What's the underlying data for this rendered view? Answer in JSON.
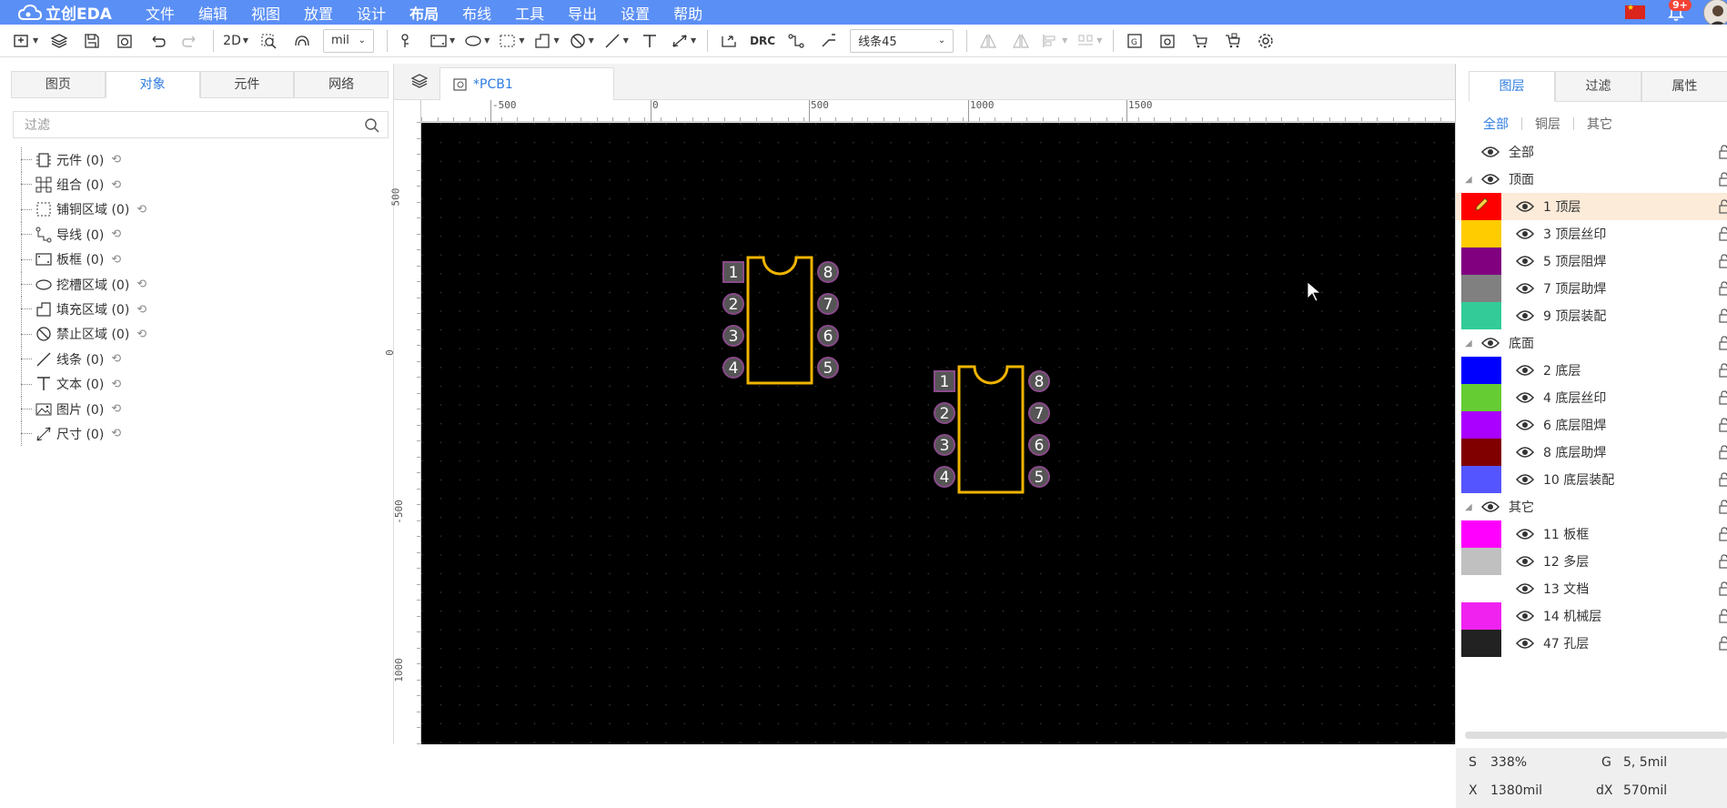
{
  "app": {
    "logo_text": "立创EDA"
  },
  "menu": [
    {
      "label": "文件"
    },
    {
      "label": "编辑"
    },
    {
      "label": "视图"
    },
    {
      "label": "放置"
    },
    {
      "label": "设计"
    },
    {
      "label": "布局",
      "active": true
    },
    {
      "label": "布线"
    },
    {
      "label": "工具"
    },
    {
      "label": "导出"
    },
    {
      "label": "设置"
    },
    {
      "label": "帮助"
    }
  ],
  "notifications": {
    "badge": "9+"
  },
  "toolbar": {
    "view_mode": "2D",
    "unit": "mil",
    "route_mode": "线条45",
    "drc_label": "DRC"
  },
  "left_panel": {
    "tabs": [
      {
        "label": "图页"
      },
      {
        "label": "对象",
        "active": true
      },
      {
        "label": "元件"
      },
      {
        "label": "网络"
      }
    ],
    "filter_placeholder": "过滤",
    "tree": [
      {
        "label": "元件 (0)",
        "icon": "component-icon"
      },
      {
        "label": "组合 (0)",
        "icon": "group-icon"
      },
      {
        "label": "铺铜区域 (0)",
        "icon": "copper-area-icon"
      },
      {
        "label": "导线 (0)",
        "icon": "track-icon"
      },
      {
        "label": "板框 (0)",
        "icon": "board-outline-icon"
      },
      {
        "label": "挖槽区域 (0)",
        "icon": "slot-area-icon"
      },
      {
        "label": "填充区域 (0)",
        "icon": "fill-area-icon"
      },
      {
        "label": "禁止区域 (0)",
        "icon": "keepout-area-icon"
      },
      {
        "label": "线条 (0)",
        "icon": "line-icon"
      },
      {
        "label": "文本 (0)",
        "icon": "text-icon"
      },
      {
        "label": "图片 (0)",
        "icon": "image-icon"
      },
      {
        "label": "尺寸 (0)",
        "icon": "dimension-icon"
      }
    ]
  },
  "canvas": {
    "doc_tab": "*PCB1",
    "top_ruler": [
      "-500",
      "0",
      "500",
      "1000",
      "1500"
    ],
    "left_ruler": [
      "500",
      "0",
      "-500",
      "1000"
    ],
    "components": [
      {
        "pins_left": [
          "1",
          "2",
          "3",
          "4"
        ],
        "pins_right": [
          "8",
          "7",
          "6",
          "5"
        ]
      },
      {
        "pins_left": [
          "1",
          "2",
          "3",
          "4"
        ],
        "pins_right": [
          "8",
          "7",
          "6",
          "5"
        ]
      }
    ]
  },
  "right_panel": {
    "tabs": [
      {
        "label": "图层",
        "active": true
      },
      {
        "label": "过滤"
      },
      {
        "label": "属性"
      }
    ],
    "filters": [
      {
        "label": "全部",
        "active": true
      },
      {
        "label": "铜层"
      },
      {
        "label": "其它"
      }
    ],
    "layers": [
      {
        "type": "all",
        "label": "全部"
      },
      {
        "type": "group",
        "label": "顶面"
      },
      {
        "type": "layer",
        "label": "1 顶层",
        "color": "#ff0000",
        "selected": true,
        "pencil": true
      },
      {
        "type": "layer",
        "label": "3 顶层丝印",
        "color": "#ffcc00"
      },
      {
        "type": "layer",
        "label": "5 顶层阻焊",
        "color": "#800080"
      },
      {
        "type": "layer",
        "label": "7 顶层助焊",
        "color": "#808080"
      },
      {
        "type": "layer",
        "label": "9 顶层装配",
        "color": "#33cc99"
      },
      {
        "type": "group",
        "label": "底面"
      },
      {
        "type": "layer",
        "label": "2 底层",
        "color": "#0000ff"
      },
      {
        "type": "layer",
        "label": "4 底层丝印",
        "color": "#66cc33"
      },
      {
        "type": "layer",
        "label": "6 底层阻焊",
        "color": "#aa00ff"
      },
      {
        "type": "layer",
        "label": "8 底层助焊",
        "color": "#800000"
      },
      {
        "type": "layer",
        "label": "10 底层装配",
        "color": "#5555ff"
      },
      {
        "type": "group",
        "label": "其它"
      },
      {
        "type": "layer",
        "label": "11 板框",
        "color": "#ff00ff"
      },
      {
        "type": "layer",
        "label": "12 多层",
        "color": "#c0c0c0"
      },
      {
        "type": "layer",
        "label": "13 文档",
        "color": "#ffffff"
      },
      {
        "type": "layer",
        "label": "14 机械层",
        "color": "#f022f0"
      },
      {
        "type": "layer",
        "label": "47 孔层",
        "color": "#222222"
      }
    ],
    "status": {
      "s_label": "S",
      "s_value": "338%",
      "g_label": "G",
      "g_value": "5, 5mil",
      "x_label": "X",
      "x_value": "1380mil",
      "dx_label": "dX",
      "dx_value": "570mil"
    }
  }
}
